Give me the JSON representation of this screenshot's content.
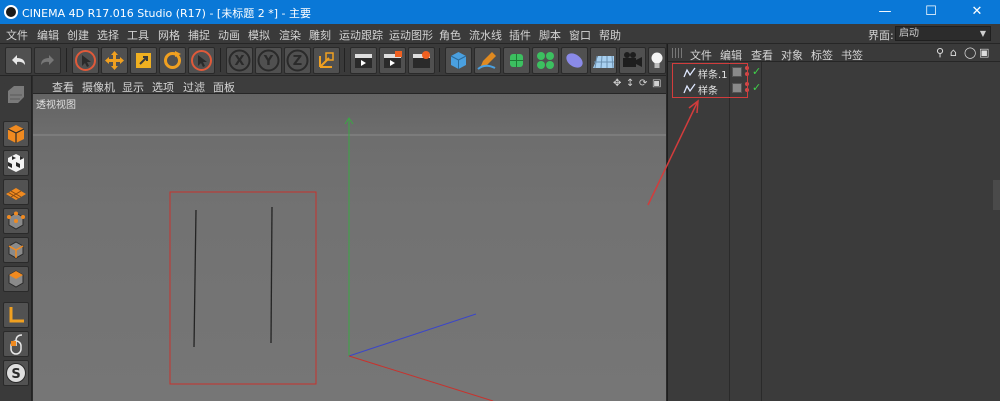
{
  "window": {
    "title": "CINEMA 4D R17.016 Studio (R17) - [未标题 2 *] - 主要",
    "minimize_icon": "minimize-icon",
    "maximize_icon": "maximize-icon",
    "close_icon": "close-icon"
  },
  "menubar": {
    "items": [
      "文件",
      "编辑",
      "创建",
      "选择",
      "工具",
      "网格",
      "捕捉",
      "动画",
      "模拟",
      "渲染",
      "雕刻",
      "运动跟踪",
      "运动图形",
      "角色",
      "流水线",
      "插件",
      "脚本",
      "窗口",
      "帮助"
    ],
    "layout_label": "界面:",
    "layout_value": "启动"
  },
  "toolbar": {
    "buttons": [
      "undo-icon",
      "redo-icon",
      "live-selection-icon",
      "move-icon",
      "scale-icon",
      "rotate-icon",
      "recent-tool-icon",
      "x-axis-icon",
      "y-axis-icon",
      "z-axis-icon",
      "coordinate-system-icon",
      "render-view-icon",
      "render-to-picture-viewer-icon",
      "render-settings-icon",
      "cube-icon",
      "pen-icon",
      "subdivision-icon",
      "cloner-icon",
      "deformer-icon",
      "floor-icon",
      "camera-icon",
      "light-icon"
    ],
    "axis_x": "X",
    "axis_y": "Y",
    "axis_z": "Z"
  },
  "leftbar": {
    "buttons": [
      "make-editable-icon",
      "model-mode-icon",
      "texture-mode-icon",
      "workplane-icon",
      "points-mode-icon",
      "edges-mode-icon",
      "polygons-mode-icon",
      "axis-mode-icon",
      "tweak-mode-icon",
      "snap-icon"
    ],
    "snap_letter": "S"
  },
  "viewport": {
    "menu": [
      "查看",
      "摄像机",
      "显示",
      "选项",
      "过滤",
      "面板"
    ],
    "label": "透视视图",
    "nav_icons": [
      "pan-icon",
      "dolly-icon",
      "orbit-icon",
      "maximize-view-icon"
    ]
  },
  "object_manager": {
    "menu": [
      "文件",
      "编辑",
      "查看",
      "对象",
      "标签",
      "书签"
    ],
    "toolbar_icons": [
      "search-icon",
      "home-icon",
      "view-icon",
      "layer-icon"
    ],
    "objects": [
      {
        "name": "样条.1",
        "icon": "spline-icon",
        "visible": true
      },
      {
        "name": "样条",
        "icon": "spline-icon",
        "visible": true
      }
    ]
  },
  "colors": {
    "title_bar": "#0a78d7",
    "selection_box": "#d23c3c",
    "axis_y": "#3cb043",
    "axis_x": "#c8322d",
    "axis_z": "#3b46c8"
  }
}
